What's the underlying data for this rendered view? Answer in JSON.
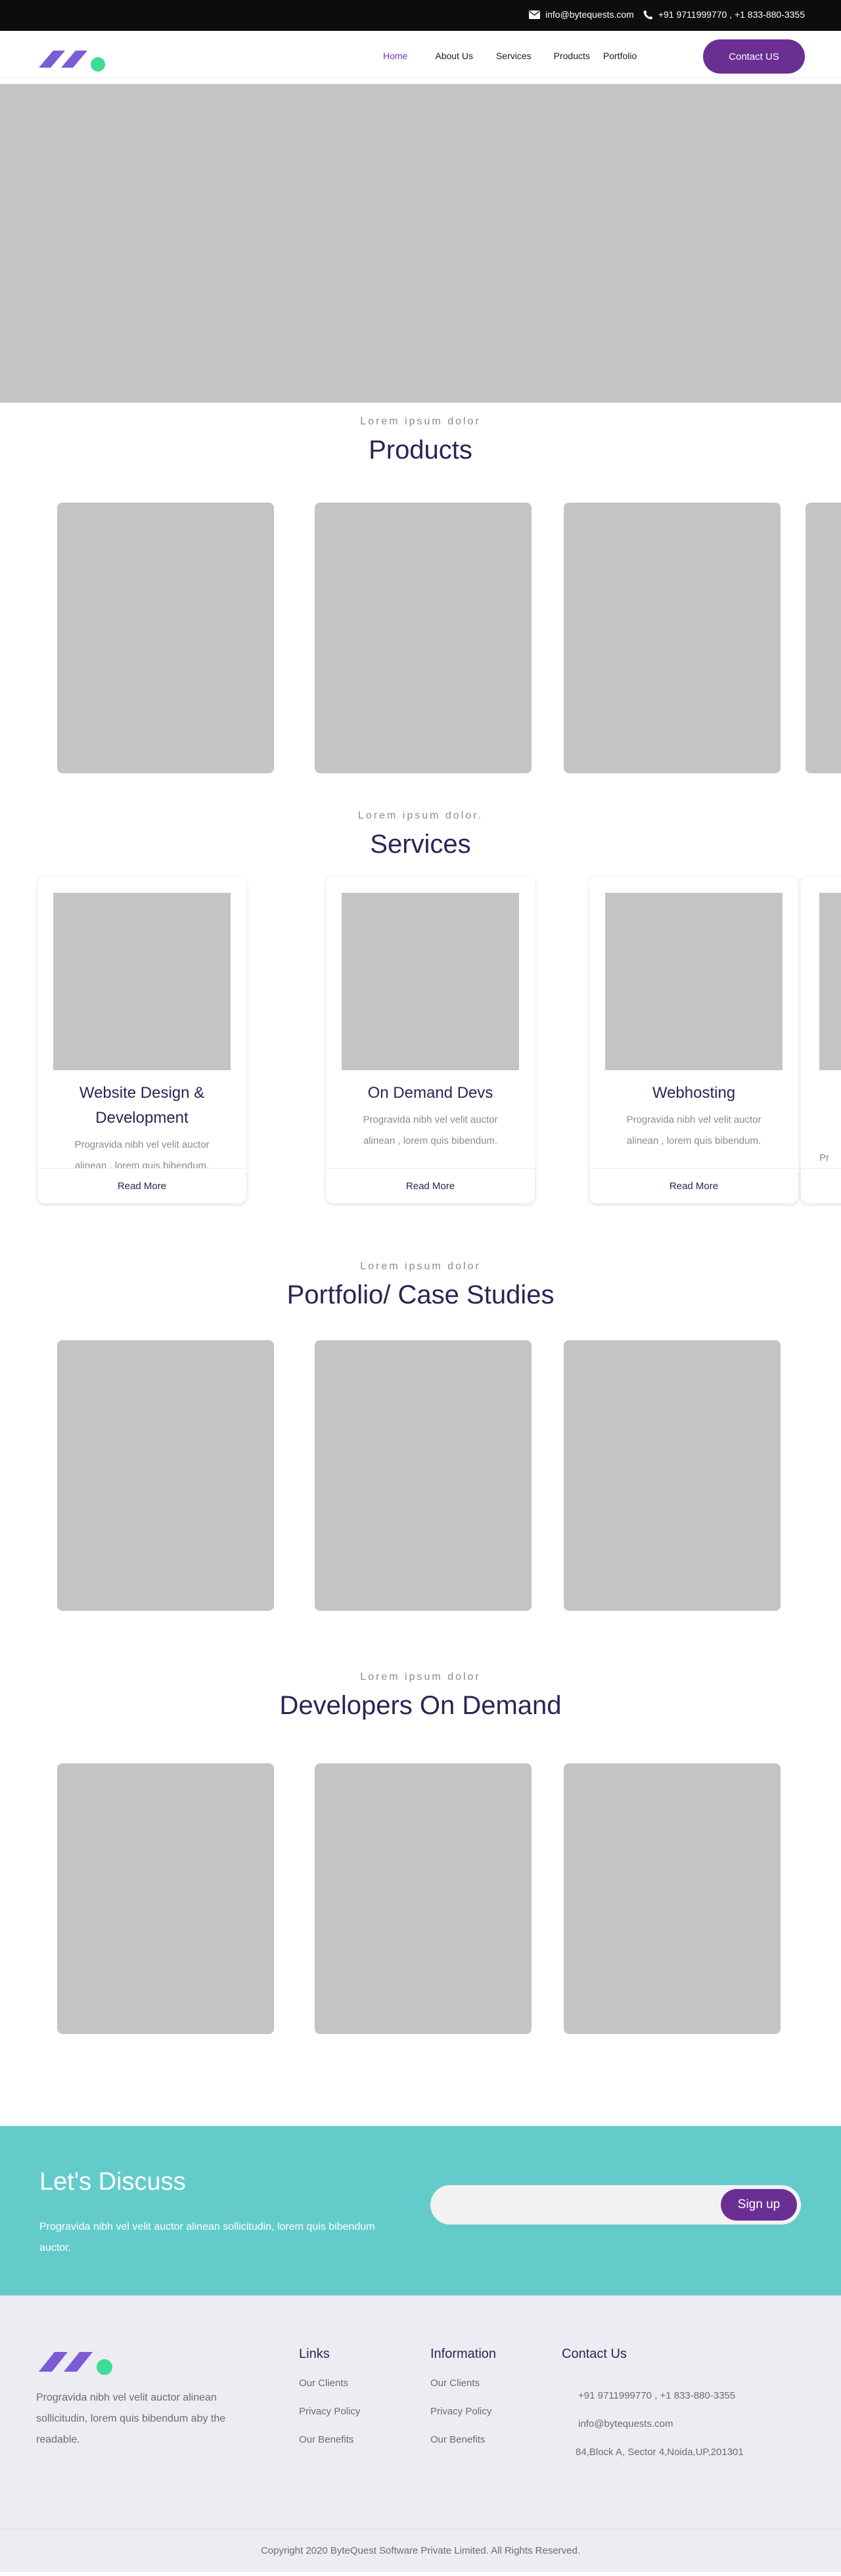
{
  "topbar": {
    "email": "info@bytequests.com",
    "phone": "+91 9711999770 , +1 833-880-3355"
  },
  "nav": {
    "items": [
      {
        "label": "Home",
        "active": true
      },
      {
        "label": "About Us"
      },
      {
        "label": "Services"
      },
      {
        "label": "Products"
      },
      {
        "label": "Portfolio"
      }
    ],
    "contact_label": "Contact US"
  },
  "brand": {
    "logo_purple": "#7b5bd6",
    "logo_green": "#3ddc97",
    "accent": "#6b2f93",
    "teal": "#63cccb"
  },
  "products": {
    "eyebrow": "Lorem ipsum dolor",
    "title": "Products"
  },
  "services": {
    "eyebrow": "Lorem ipsum dolor.",
    "title": "Services",
    "items": [
      {
        "title": "Website Design & Development",
        "desc": "Progravida nibh vel velit auctor alinean , lorem quis bibendum.",
        "cta": "Read More"
      },
      {
        "title": "On Demand Devs",
        "desc": "Progravida nibh vel velit auctor alinean , lorem quis bibendum.",
        "cta": "Read More"
      },
      {
        "title": "Webhosting",
        "desc": "Progravida nibh vel velit auctor alinean , lorem quis bibendum.",
        "cta": "Read More"
      }
    ],
    "partial_desc": "Pr al"
  },
  "portfolio": {
    "eyebrow": "Lorem ipsum dolor",
    "title": "Portfolio/ Case Studies"
  },
  "developers": {
    "eyebrow": "Lorem ipsum dolor",
    "title": "Developers On Demand"
  },
  "discuss": {
    "title": "Let's Discuss",
    "text": "Progravida nibh vel velit auctor alinean sollicitudin, lorem quis bibendum auctor.",
    "input_placeholder": "",
    "button": "Sign up"
  },
  "footer": {
    "about": "Progravida nibh vel velit auctor alinean sollicitudin, lorem quis bibendum aby the readable.",
    "links": {
      "title": "Links",
      "items": [
        "Our Clients",
        "Privacy Policy",
        "Our Benefits"
      ]
    },
    "information": {
      "title": "Information",
      "items": [
        "Our Clients",
        "Privacy Policy",
        "Our Benefits"
      ]
    },
    "contact": {
      "title": "Contact Us",
      "phone": "+91 9711999770 , +1 833-880-3355",
      "email": "info@bytequests.com",
      "address": "84,Block A, Sector 4,Noida,UP,201301"
    }
  },
  "copyright": "Copyright 2020 ByteQuest Software Private Limited. All Rights Reserved."
}
